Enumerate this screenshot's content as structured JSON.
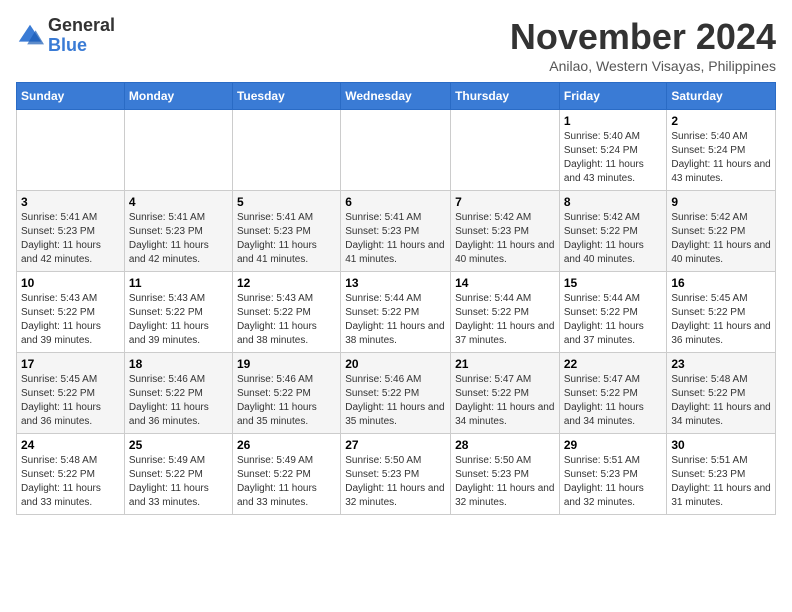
{
  "logo": {
    "general": "General",
    "blue": "Blue"
  },
  "header": {
    "month": "November 2024",
    "location": "Anilao, Western Visayas, Philippines"
  },
  "weekdays": [
    "Sunday",
    "Monday",
    "Tuesday",
    "Wednesday",
    "Thursday",
    "Friday",
    "Saturday"
  ],
  "weeks": [
    [
      {
        "day": "",
        "info": ""
      },
      {
        "day": "",
        "info": ""
      },
      {
        "day": "",
        "info": ""
      },
      {
        "day": "",
        "info": ""
      },
      {
        "day": "",
        "info": ""
      },
      {
        "day": "1",
        "info": "Sunrise: 5:40 AM\nSunset: 5:24 PM\nDaylight: 11 hours and 43 minutes."
      },
      {
        "day": "2",
        "info": "Sunrise: 5:40 AM\nSunset: 5:24 PM\nDaylight: 11 hours and 43 minutes."
      }
    ],
    [
      {
        "day": "3",
        "info": "Sunrise: 5:41 AM\nSunset: 5:23 PM\nDaylight: 11 hours and 42 minutes."
      },
      {
        "day": "4",
        "info": "Sunrise: 5:41 AM\nSunset: 5:23 PM\nDaylight: 11 hours and 42 minutes."
      },
      {
        "day": "5",
        "info": "Sunrise: 5:41 AM\nSunset: 5:23 PM\nDaylight: 11 hours and 41 minutes."
      },
      {
        "day": "6",
        "info": "Sunrise: 5:41 AM\nSunset: 5:23 PM\nDaylight: 11 hours and 41 minutes."
      },
      {
        "day": "7",
        "info": "Sunrise: 5:42 AM\nSunset: 5:23 PM\nDaylight: 11 hours and 40 minutes."
      },
      {
        "day": "8",
        "info": "Sunrise: 5:42 AM\nSunset: 5:22 PM\nDaylight: 11 hours and 40 minutes."
      },
      {
        "day": "9",
        "info": "Sunrise: 5:42 AM\nSunset: 5:22 PM\nDaylight: 11 hours and 40 minutes."
      }
    ],
    [
      {
        "day": "10",
        "info": "Sunrise: 5:43 AM\nSunset: 5:22 PM\nDaylight: 11 hours and 39 minutes."
      },
      {
        "day": "11",
        "info": "Sunrise: 5:43 AM\nSunset: 5:22 PM\nDaylight: 11 hours and 39 minutes."
      },
      {
        "day": "12",
        "info": "Sunrise: 5:43 AM\nSunset: 5:22 PM\nDaylight: 11 hours and 38 minutes."
      },
      {
        "day": "13",
        "info": "Sunrise: 5:44 AM\nSunset: 5:22 PM\nDaylight: 11 hours and 38 minutes."
      },
      {
        "day": "14",
        "info": "Sunrise: 5:44 AM\nSunset: 5:22 PM\nDaylight: 11 hours and 37 minutes."
      },
      {
        "day": "15",
        "info": "Sunrise: 5:44 AM\nSunset: 5:22 PM\nDaylight: 11 hours and 37 minutes."
      },
      {
        "day": "16",
        "info": "Sunrise: 5:45 AM\nSunset: 5:22 PM\nDaylight: 11 hours and 36 minutes."
      }
    ],
    [
      {
        "day": "17",
        "info": "Sunrise: 5:45 AM\nSunset: 5:22 PM\nDaylight: 11 hours and 36 minutes."
      },
      {
        "day": "18",
        "info": "Sunrise: 5:46 AM\nSunset: 5:22 PM\nDaylight: 11 hours and 36 minutes."
      },
      {
        "day": "19",
        "info": "Sunrise: 5:46 AM\nSunset: 5:22 PM\nDaylight: 11 hours and 35 minutes."
      },
      {
        "day": "20",
        "info": "Sunrise: 5:46 AM\nSunset: 5:22 PM\nDaylight: 11 hours and 35 minutes."
      },
      {
        "day": "21",
        "info": "Sunrise: 5:47 AM\nSunset: 5:22 PM\nDaylight: 11 hours and 34 minutes."
      },
      {
        "day": "22",
        "info": "Sunrise: 5:47 AM\nSunset: 5:22 PM\nDaylight: 11 hours and 34 minutes."
      },
      {
        "day": "23",
        "info": "Sunrise: 5:48 AM\nSunset: 5:22 PM\nDaylight: 11 hours and 34 minutes."
      }
    ],
    [
      {
        "day": "24",
        "info": "Sunrise: 5:48 AM\nSunset: 5:22 PM\nDaylight: 11 hours and 33 minutes."
      },
      {
        "day": "25",
        "info": "Sunrise: 5:49 AM\nSunset: 5:22 PM\nDaylight: 11 hours and 33 minutes."
      },
      {
        "day": "26",
        "info": "Sunrise: 5:49 AM\nSunset: 5:22 PM\nDaylight: 11 hours and 33 minutes."
      },
      {
        "day": "27",
        "info": "Sunrise: 5:50 AM\nSunset: 5:23 PM\nDaylight: 11 hours and 32 minutes."
      },
      {
        "day": "28",
        "info": "Sunrise: 5:50 AM\nSunset: 5:23 PM\nDaylight: 11 hours and 32 minutes."
      },
      {
        "day": "29",
        "info": "Sunrise: 5:51 AM\nSunset: 5:23 PM\nDaylight: 11 hours and 32 minutes."
      },
      {
        "day": "30",
        "info": "Sunrise: 5:51 AM\nSunset: 5:23 PM\nDaylight: 11 hours and 31 minutes."
      }
    ]
  ]
}
